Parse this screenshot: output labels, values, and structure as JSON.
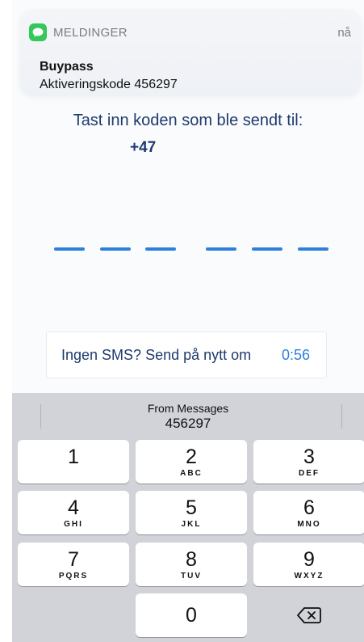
{
  "notification": {
    "app_name": "MELDINGER",
    "time": "nå",
    "sender": "Buypass",
    "body": "Aktiveringskode 456297"
  },
  "prompt": "Tast inn koden som ble sendt til:",
  "phone_prefix": "+47",
  "resend": {
    "label": "Ingen SMS? Send på nytt om",
    "timer": "0:56"
  },
  "keyboard": {
    "suggestion_title": "From Messages",
    "suggestion_value": "456297",
    "keys": [
      {
        "digit": "1",
        "letters": ""
      },
      {
        "digit": "2",
        "letters": "ABC"
      },
      {
        "digit": "3",
        "letters": "DEF"
      },
      {
        "digit": "4",
        "letters": "GHI"
      },
      {
        "digit": "5",
        "letters": "JKL"
      },
      {
        "digit": "6",
        "letters": "MNO"
      },
      {
        "digit": "7",
        "letters": "PQRS"
      },
      {
        "digit": "8",
        "letters": "TUV"
      },
      {
        "digit": "9",
        "letters": "WXYZ"
      },
      {
        "digit": "0",
        "letters": ""
      }
    ],
    "backspace_icon": "backspace-icon"
  },
  "colors": {
    "accent": "#2e80dd",
    "text_dark_blue": "#1e3a6e",
    "messages_green": "#34c759"
  }
}
